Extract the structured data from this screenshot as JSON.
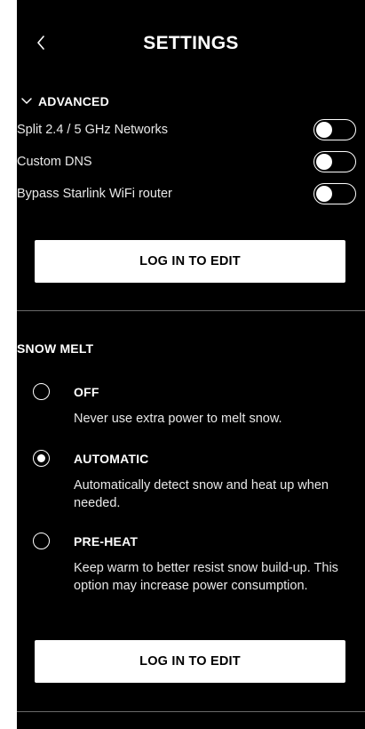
{
  "header": {
    "title": "SETTINGS",
    "back_icon": "chevron-left-icon"
  },
  "advanced": {
    "label": "ADVANCED",
    "icon": "chevron-down-icon",
    "toggles": [
      {
        "label": "Split 2.4 / 5 GHz Networks",
        "on": false
      },
      {
        "label": "Custom DNS",
        "on": false
      },
      {
        "label": "Bypass Starlink WiFi router",
        "on": false
      }
    ],
    "login_button": "LOG IN TO EDIT"
  },
  "snow_melt": {
    "title": "SNOW MELT",
    "options": [
      {
        "title": "OFF",
        "description": "Never use extra power to melt snow.",
        "selected": false
      },
      {
        "title": "AUTOMATIC",
        "description": "Automatically detect snow and heat up when needed.",
        "selected": true
      },
      {
        "title": "PRE-HEAT",
        "description": "Keep warm to better resist snow build-up. This option may increase power consumption.",
        "selected": false
      }
    ],
    "login_button": "LOG IN TO EDIT"
  },
  "colors": {
    "background": "#000000",
    "foreground": "#ffffff",
    "divider": "#6a6a6a",
    "page": "#ffffff"
  }
}
